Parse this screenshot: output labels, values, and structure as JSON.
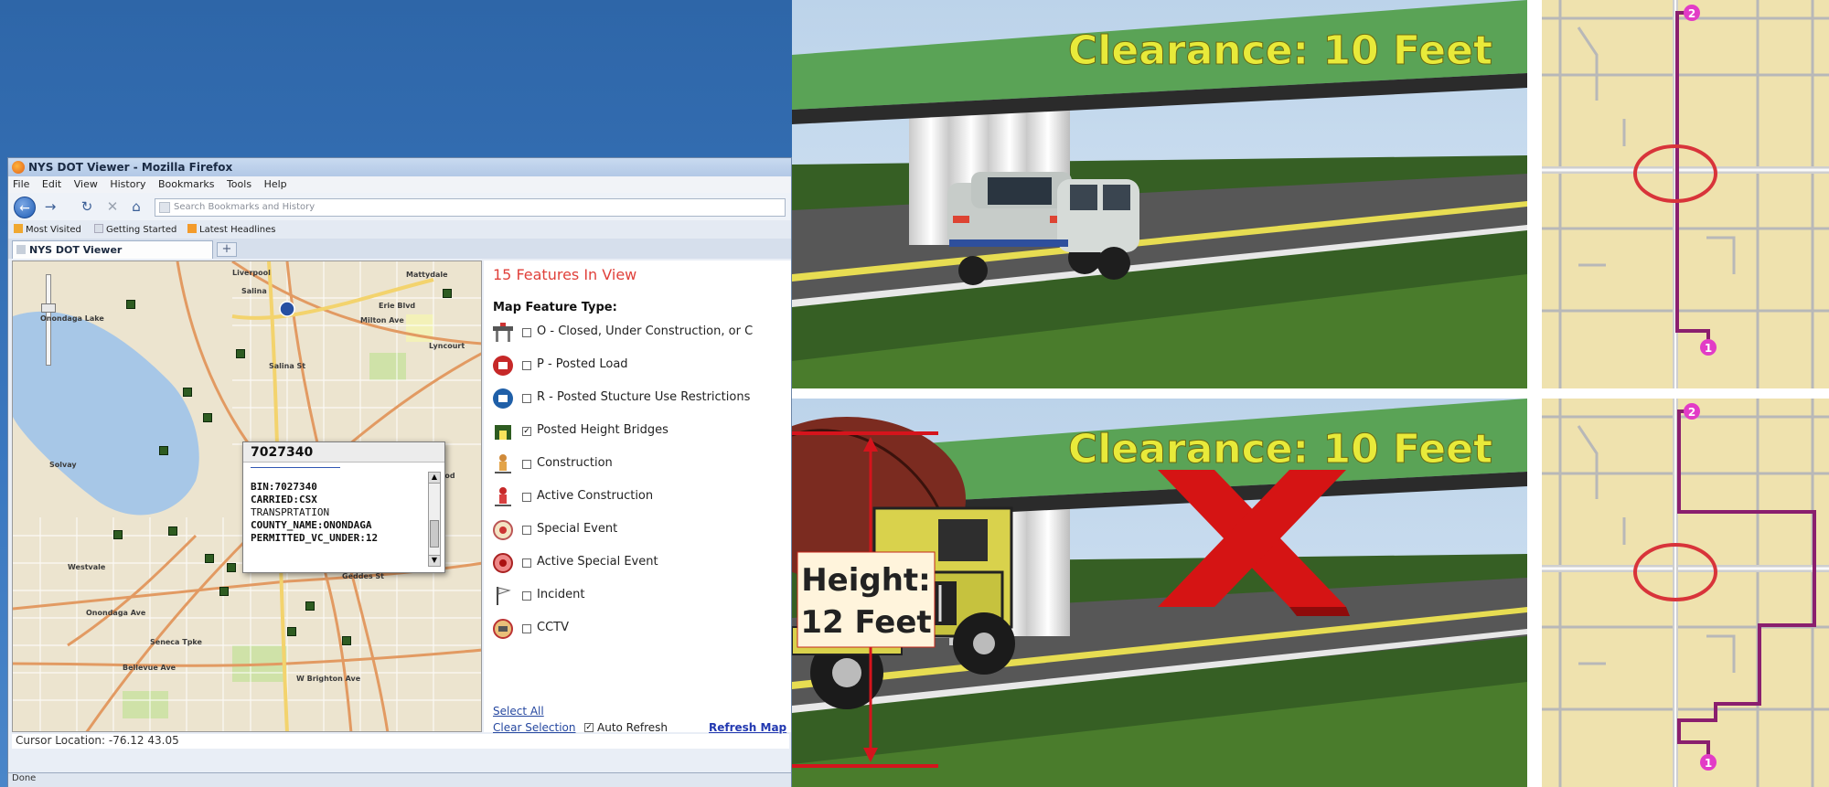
{
  "browser": {
    "window_title": "NYS DOT Viewer - Mozilla Firefox",
    "menu": [
      "File",
      "Edit",
      "View",
      "History",
      "Bookmarks",
      "Tools",
      "Help"
    ],
    "url_placeholder": "Search Bookmarks and History",
    "bookmarks": [
      "Most Visited",
      "Getting Started",
      "Latest Headlines"
    ],
    "tab_title": "NYS DOT Viewer",
    "status_location": "Cursor Location: -76.12  43.05",
    "status_done": "Done"
  },
  "map": {
    "labels": [
      "Onondaga Lake",
      "Solvay",
      "Westvale",
      "Liverpool",
      "Salina",
      "Mattydale",
      "Lyncourt",
      "Eastwood",
      "Onondaga Ave",
      "W Brighton Ave",
      "Salina St",
      "Erie Blvd",
      "Geddes St",
      "Milton Ave",
      "Seneca Tpke",
      "Bellevue Ave"
    ],
    "popup": {
      "title": "7027340",
      "lines": [
        "BIN:7027340",
        "CARRIED:CSX",
        "TRANSPRTATION",
        "COUNTY_NAME:ONONDAGA",
        "PERMITTED_VC_UNDER:12"
      ]
    }
  },
  "panel": {
    "count_text": "15 Features In View",
    "feature_type_label": "Map Feature Type:",
    "features": [
      {
        "label": "O - Closed, Under Construction, or C",
        "checked": false,
        "icon": "closed-bridge-icon"
      },
      {
        "label": "P - Posted Load",
        "checked": false,
        "icon": "posted-load-icon"
      },
      {
        "label": "R - Posted Stucture Use Restrictions",
        "checked": false,
        "icon": "restriction-icon"
      },
      {
        "label": "Posted Height Bridges",
        "checked": true,
        "icon": "height-bridge-icon"
      },
      {
        "label": "Construction",
        "checked": false,
        "icon": "construction-icon"
      },
      {
        "label": "Active Construction",
        "checked": false,
        "icon": "active-construction-icon"
      },
      {
        "label": "Special Event",
        "checked": false,
        "icon": "special-event-icon"
      },
      {
        "label": "Active Special Event",
        "checked": false,
        "icon": "active-special-event-icon"
      },
      {
        "label": "Incident",
        "checked": false,
        "icon": "incident-flag-icon"
      },
      {
        "label": "CCTV",
        "checked": false,
        "icon": "cctv-icon"
      }
    ],
    "select_all": "Select All",
    "clear_selection": "Clear Selection",
    "auto_refresh": "Auto Refresh",
    "auto_refresh_checked": true,
    "refresh_map": "Refresh Map"
  },
  "scenes": {
    "top_sign": "Clearance: 10 Feet",
    "bottom_sign": "Clearance: 10 Feet",
    "height_label_line1": "Height:",
    "height_label_line2": "12 Feet",
    "blocked_mark": "X"
  },
  "routes": {
    "start_label": "1",
    "end_label": "2"
  },
  "colors": {
    "sign_green": "#4e9a4a",
    "sign_text": "#e8ea3a",
    "x_red": "#d51414",
    "route_purple": "#8a1f6e",
    "map_base": "#efe2ae",
    "circle_red": "#d8343a",
    "count_red": "#e0413b"
  }
}
